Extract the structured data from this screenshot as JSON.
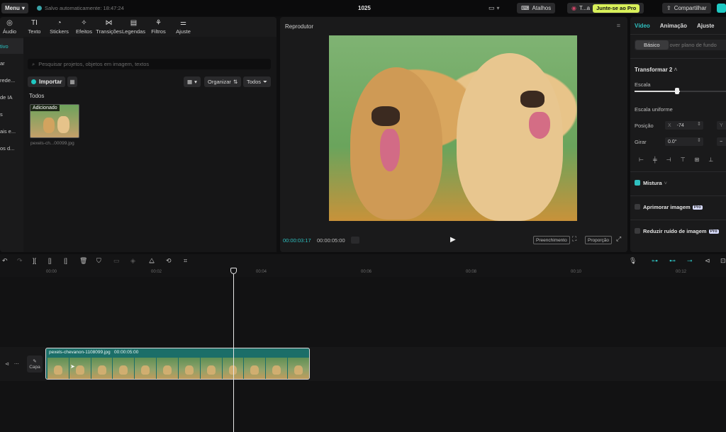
{
  "topbar": {
    "menu_label": "Menu",
    "autosave_text": "Salvo automaticamente: 18:47:24",
    "project_title": "1025",
    "shortcuts_label": "Atalhos",
    "team_label": "T...a",
    "pro_label": "Junte-se ao Pro",
    "share_label": "Compartilhar"
  },
  "tools": [
    {
      "icon": "audio-icon",
      "glyph": "◎",
      "label": "Áudio"
    },
    {
      "icon": "text-icon",
      "glyph": "TI",
      "label": "Texto"
    },
    {
      "icon": "sticker-icon",
      "glyph": "◔",
      "label": "Stickers"
    },
    {
      "icon": "effects-icon",
      "glyph": "✧",
      "label": "Efeitos"
    },
    {
      "icon": "transitions-icon",
      "glyph": "⋈",
      "label": "Transições"
    },
    {
      "icon": "captions-icon",
      "glyph": "▤",
      "label": "Legendas"
    },
    {
      "icon": "filters-icon",
      "glyph": "⚘",
      "label": "Filtros"
    },
    {
      "icon": "adjust-icon",
      "glyph": "⚌",
      "label": "Ajuste"
    }
  ],
  "left_rail": [
    "tivo",
    "ar",
    "rede...",
    "de IA",
    "s",
    "ais e...",
    "os d..."
  ],
  "media": {
    "search_placeholder": "Pesquisar projetos, objetos em imagem, textos",
    "import_label": "Importar",
    "organize_label": "Organizar",
    "filter_label": "Todos",
    "section_label": "Todos",
    "thumb_tag": "Adicionado",
    "thumb_name": "pexels-ch...00099.jpg"
  },
  "player": {
    "title": "Reprodutor",
    "current_time": "00:00:03:17",
    "total_time": "00:00:05:00",
    "fill_label": "Preenchimento",
    "ratio_label": "Proporção"
  },
  "right_panel": {
    "tabs": [
      "Vídeo",
      "Animação",
      "Ajuste"
    ],
    "seg_on": "Básico",
    "seg_off": "over plano de fundo",
    "transform_label": "Transformar 2",
    "scale_label": "Escala",
    "uniform_label": "Escala uniforme",
    "position_label": "Posição",
    "pos_x_axis": "X",
    "pos_x_value": "-74",
    "pos_y_axis": "Y",
    "rotate_label": "Girar",
    "rotate_value": "0.0°",
    "blend_label": "Mistura",
    "enhance_label": "Aprimorar imagem",
    "denoise_label": "Reduzir ruído de imagem",
    "pro_badge": "Pro"
  },
  "timeline": {
    "ticks": [
      "00:00",
      "00:02",
      "00:04",
      "00:06",
      "00:08",
      "00:10",
      "00:12"
    ],
    "clip_name": "pexels-chevanon-1108099.jpg",
    "clip_duration": "00:00:05:00",
    "cover_label": "Capa"
  }
}
